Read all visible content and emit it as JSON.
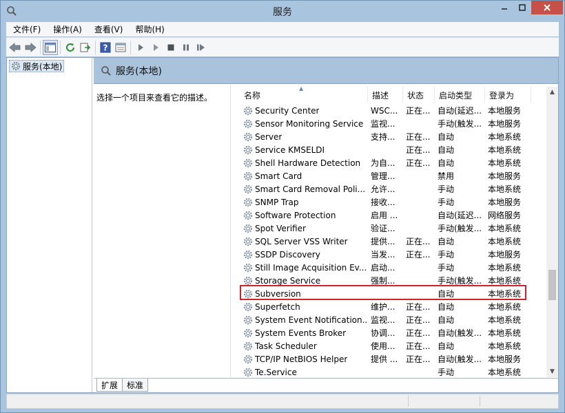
{
  "window": {
    "title": "服务"
  },
  "menu": [
    "文件(F)",
    "操作(A)",
    "查看(V)",
    "帮助(H)"
  ],
  "tree": {
    "root": "服务(本地)"
  },
  "pane": {
    "title": "服务(本地)",
    "description": "选择一个项目来查看它的描述。"
  },
  "columns": {
    "name": "名称",
    "desc": "描述",
    "status": "状态",
    "startup": "启动类型",
    "logon": "登录为"
  },
  "rows": [
    {
      "name": "Security Center",
      "desc": "WSC...",
      "status": "正在...",
      "startup": "自动(延迟...",
      "logon": "本地服务"
    },
    {
      "name": "Sensor Monitoring Service",
      "desc": "监视...",
      "status": "",
      "startup": "手动(触发...",
      "logon": "本地服务"
    },
    {
      "name": "Server",
      "desc": "支持...",
      "status": "正在...",
      "startup": "自动",
      "logon": "本地系统"
    },
    {
      "name": "Service KMSELDI",
      "desc": "",
      "status": "正在...",
      "startup": "自动",
      "logon": "本地系统"
    },
    {
      "name": "Shell Hardware Detection",
      "desc": "为自...",
      "status": "正在...",
      "startup": "自动",
      "logon": "本地系统"
    },
    {
      "name": "Smart Card",
      "desc": "管理...",
      "status": "",
      "startup": "禁用",
      "logon": "本地服务"
    },
    {
      "name": "Smart Card Removal Poli...",
      "desc": "允许...",
      "status": "",
      "startup": "手动",
      "logon": "本地系统"
    },
    {
      "name": "SNMP Trap",
      "desc": "接收...",
      "status": "",
      "startup": "手动",
      "logon": "本地服务"
    },
    {
      "name": "Software Protection",
      "desc": "启用 ...",
      "status": "",
      "startup": "自动(延迟...",
      "logon": "网络服务"
    },
    {
      "name": "Spot Verifier",
      "desc": "验证...",
      "status": "",
      "startup": "手动(触发...",
      "logon": "本地系统"
    },
    {
      "name": "SQL Server VSS Writer",
      "desc": "提供...",
      "status": "正在...",
      "startup": "自动",
      "logon": "本地系统"
    },
    {
      "name": "SSDP Discovery",
      "desc": "当发...",
      "status": "正在...",
      "startup": "手动",
      "logon": "本地服务"
    },
    {
      "name": "Still Image Acquisition Ev...",
      "desc": "启动...",
      "status": "",
      "startup": "手动",
      "logon": "本地系统"
    },
    {
      "name": "Storage Service",
      "desc": "强制...",
      "status": "",
      "startup": "手动(触发...",
      "logon": "本地系统"
    },
    {
      "name": "Subversion",
      "desc": "",
      "status": "",
      "startup": "自动",
      "logon": "本地系统"
    },
    {
      "name": "Superfetch",
      "desc": "维护...",
      "status": "正在...",
      "startup": "自动",
      "logon": "本地系统"
    },
    {
      "name": "System Event Notification...",
      "desc": "监视...",
      "status": "正在...",
      "startup": "自动",
      "logon": "本地系统"
    },
    {
      "name": "System Events Broker",
      "desc": "协调...",
      "status": "正在...",
      "startup": "自动(触发...",
      "logon": "本地系统"
    },
    {
      "name": "Task Scheduler",
      "desc": "使用...",
      "status": "正在...",
      "startup": "自动",
      "logon": "本地系统"
    },
    {
      "name": "TCP/IP NetBIOS Helper",
      "desc": "提供 ...",
      "status": "正在...",
      "startup": "自动(触发...",
      "logon": "本地服务"
    },
    {
      "name": "Te.Service",
      "desc": "",
      "status": "",
      "startup": "手动",
      "logon": "本地系统"
    }
  ],
  "tabs": [
    "扩展",
    "标准"
  ],
  "colors": {
    "chrome": "#a9c4de",
    "highlight": "#d0202a",
    "close": "#c7504a"
  }
}
